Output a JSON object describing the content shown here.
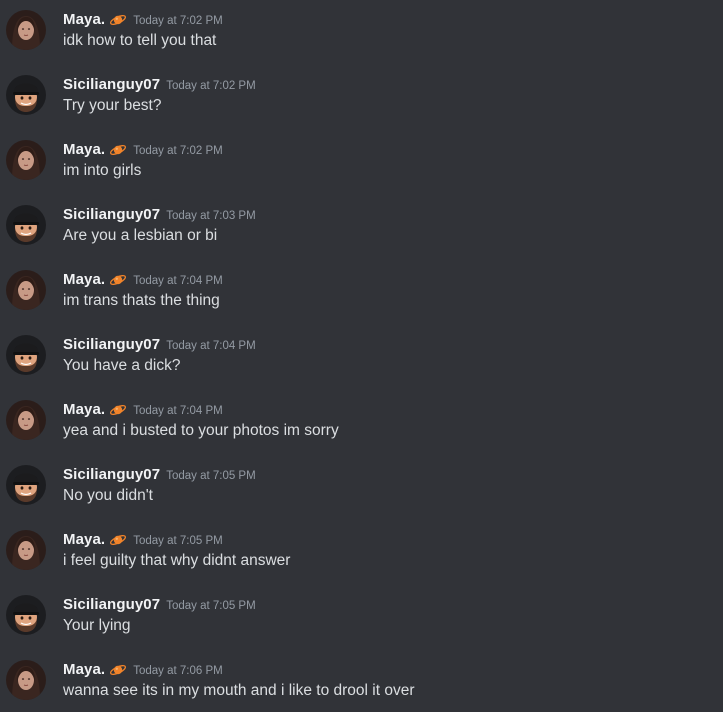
{
  "channel": {
    "messages": [
      {
        "author": "Maya.",
        "avatar": "maya-avatar",
        "badge": "planet-icon",
        "timestamp": "Today at 7:02 PM",
        "text": "idk how to tell you that"
      },
      {
        "author": "Sicilianguy07",
        "avatar": "sicilianguy-avatar",
        "badge": "",
        "timestamp": "Today at 7:02 PM",
        "text": "Try your best?"
      },
      {
        "author": "Maya.",
        "avatar": "maya-avatar",
        "badge": "planet-icon",
        "timestamp": "Today at 7:02 PM",
        "text": "im into girls"
      },
      {
        "author": "Sicilianguy07",
        "avatar": "sicilianguy-avatar",
        "badge": "",
        "timestamp": "Today at 7:03 PM",
        "text": "Are you a lesbian or bi"
      },
      {
        "author": "Maya.",
        "avatar": "maya-avatar",
        "badge": "planet-icon",
        "timestamp": "Today at 7:04 PM",
        "text": "im trans thats the thing"
      },
      {
        "author": "Sicilianguy07",
        "avatar": "sicilianguy-avatar",
        "badge": "",
        "timestamp": "Today at 7:04 PM",
        "text": "You have a dick?"
      },
      {
        "author": "Maya.",
        "avatar": "maya-avatar",
        "badge": "planet-icon",
        "timestamp": "Today at 7:04 PM",
        "text": "yea and i busted to your photos im sorry"
      },
      {
        "author": "Sicilianguy07",
        "avatar": "sicilianguy-avatar",
        "badge": "",
        "timestamp": "Today at 7:05 PM",
        "text": "No you didn't"
      },
      {
        "author": "Maya.",
        "avatar": "maya-avatar",
        "badge": "planet-icon",
        "timestamp": "Today at 7:05 PM",
        "text": "i feel guilty that why didnt answer"
      },
      {
        "author": "Sicilianguy07",
        "avatar": "sicilianguy-avatar",
        "badge": "",
        "timestamp": "Today at 7:05 PM",
        "text": "Your lying"
      },
      {
        "author": "Maya.",
        "avatar": "maya-avatar",
        "badge": "planet-icon",
        "timestamp": "Today at 7:06 PM",
        "text": "wanna see its in my mouth and i like to drool it over"
      }
    ]
  },
  "colors": {
    "background": "#313338",
    "username": "#f2f3f5",
    "timestamp": "#949ba4",
    "message_text": "#dbdee1",
    "planet_badge": "#f0832a"
  }
}
